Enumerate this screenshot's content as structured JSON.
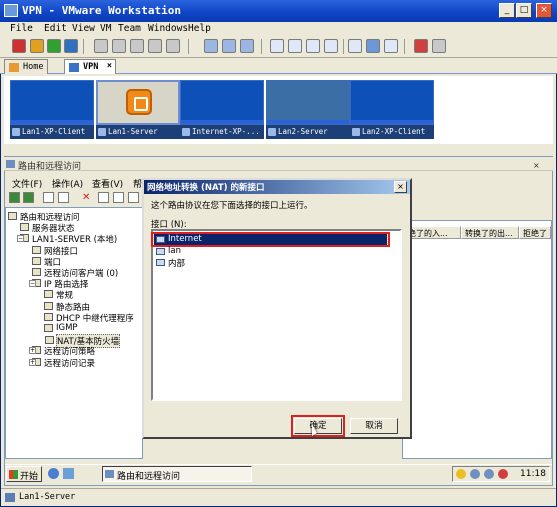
{
  "window": {
    "title": "VPN - VMware Workstation",
    "minimize_label": "_",
    "maximize_label": "□",
    "close_label": "×"
  },
  "menubar": [
    "File",
    "Edit",
    "View",
    "VM",
    "Team",
    "Windows",
    "Help"
  ],
  "tabs": [
    {
      "label": "Home",
      "icon": "home-icon"
    },
    {
      "label": "VPN",
      "icon": "vpn-icon",
      "close": "×"
    }
  ],
  "vms": [
    {
      "label": "Lan1-XP-Client"
    },
    {
      "label": "Lan1-Server"
    },
    {
      "label": "Internet-XP-..."
    },
    {
      "label": "Lan2-Server"
    },
    {
      "label": "Lan2-XP-Client"
    }
  ],
  "guest": {
    "rras_window_title": "路由和远程访问",
    "menu": [
      "文件(F)",
      "操作(A)",
      "查看(V)",
      "帮"
    ],
    "tree": [
      {
        "label": "路由和远程访问",
        "level": 0
      },
      {
        "label": "服务器状态",
        "level": 1
      },
      {
        "label": "LAN1-SERVER (本地)",
        "level": 1
      },
      {
        "label": "网络接口",
        "level": 2
      },
      {
        "label": "端口",
        "level": 2
      },
      {
        "label": "远程访问客户端 (0)",
        "level": 2
      },
      {
        "label": "IP 路由选择",
        "level": 2
      },
      {
        "label": "常规",
        "level": 3
      },
      {
        "label": "静态路由",
        "level": 3
      },
      {
        "label": "DHCP 中继代理程序",
        "level": 3
      },
      {
        "label": "IGMP",
        "level": 3
      },
      {
        "label": "NAT/基本防火墙",
        "level": 3
      },
      {
        "label": "远程访问策略",
        "level": 2
      },
      {
        "label": "远程访问记录",
        "level": 2
      }
    ],
    "columns": [
      "绝了的入...",
      "转换了的出...",
      "拒绝了"
    ],
    "dialog": {
      "title": "网络地址转换 (NAT) 的新接口",
      "description": "这个路由协议在您下面选择的接口上运行。",
      "list_label": "接口 (N):",
      "interfaces": [
        {
          "label": "Internet",
          "selected": true
        },
        {
          "label": "lan",
          "selected": false
        },
        {
          "label": "内部",
          "selected": false
        }
      ],
      "ok_label": "确定",
      "cancel_label": "取消",
      "close_label": "×"
    },
    "taskbar": {
      "start_label": "开始",
      "task_label": "路由和远程访问",
      "clock": "11:18"
    }
  },
  "status": {
    "text": "Lan1-Server"
  },
  "colors": {
    "title_bar": "#0e44c5",
    "selection": "#0a246a",
    "highlight_box": "#e02020",
    "guest_desktop": "#0d50b8"
  }
}
